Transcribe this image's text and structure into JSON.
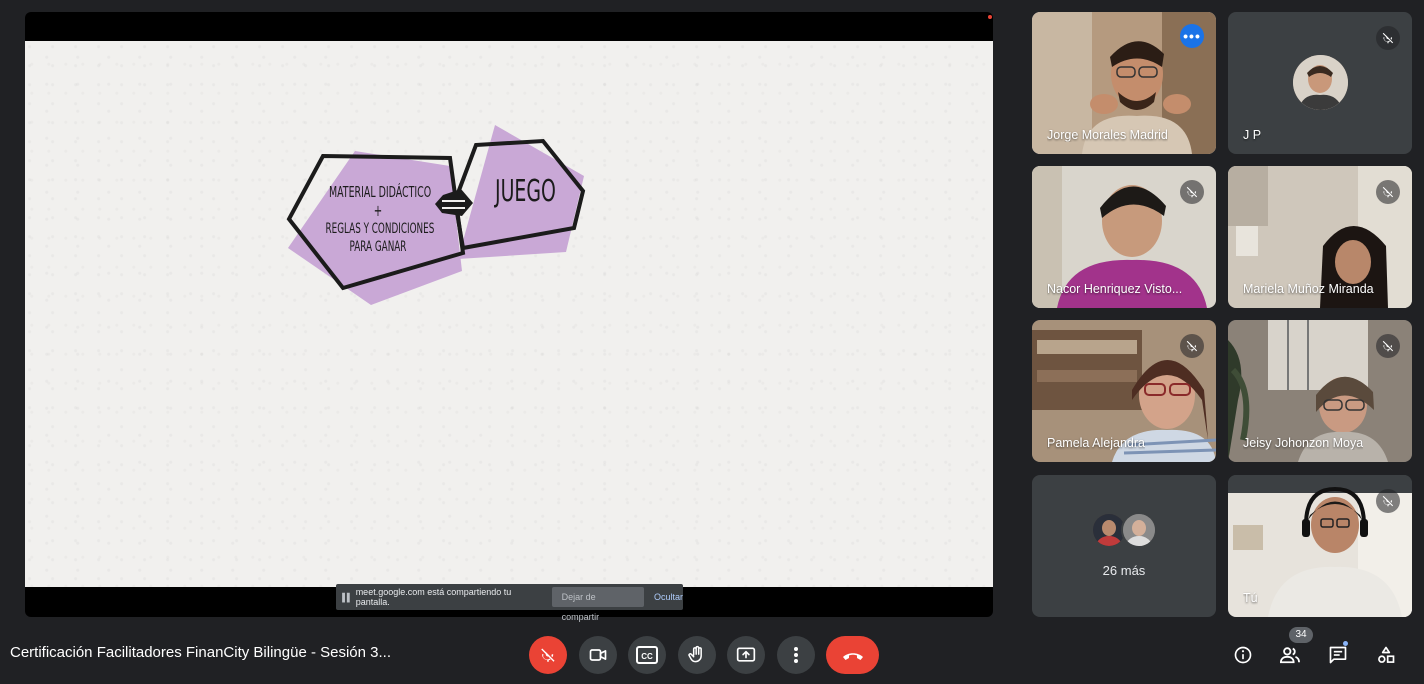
{
  "presentation": {
    "slide": {
      "left_shape_line1": "Material didáctico",
      "left_shape_plus": "+",
      "left_shape_line2": "Reglas y condiciones",
      "left_shape_line3": "para ganar",
      "right_shape": "Juego"
    },
    "share_banner": {
      "message": "meet.google.com está compartiendo tu pantalla.",
      "stop_label": "Dejar de compartir",
      "hide_label": "Ocultar"
    }
  },
  "participants": [
    {
      "name": "Jorge Morales Madrid",
      "active": true
    },
    {
      "name": "J P",
      "muted": true
    },
    {
      "name": "Nacor Henriquez Visto...",
      "muted": true
    },
    {
      "name": "Mariela Muñoz Miranda",
      "muted": true
    },
    {
      "name": "Pamela Alejandra",
      "muted": true
    },
    {
      "name": "Jeisy Johonzon Moya",
      "muted": true
    },
    {
      "more_label": "26 más"
    },
    {
      "name": "Tú",
      "muted": true
    }
  ],
  "bottom_bar": {
    "meeting_title": "Certificación Facilitadores FinanCity Bilingüe - Sesión 3...",
    "cc_label": "CC",
    "people_count": "34"
  },
  "colors": {
    "background": "#202124",
    "tile": "#3c4043",
    "accent_blue": "#8ab4f8",
    "danger_red": "#ea4335",
    "slide_purple": "#c9a8d6"
  }
}
